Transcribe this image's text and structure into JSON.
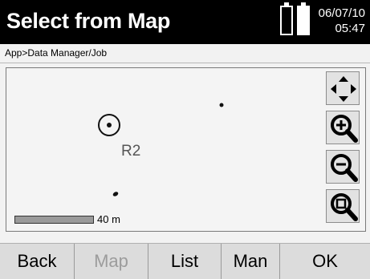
{
  "header": {
    "title": "Select from Map",
    "date": "06/07/10",
    "time": "05:47"
  },
  "breadcrumb": "App>Data Manager/Job",
  "map": {
    "selected_point_label": "R2",
    "scale_label": "40 m"
  },
  "map_controls": [
    {
      "name": "pan-button",
      "icon": "pan-arrows-icon"
    },
    {
      "name": "zoom-in-button",
      "icon": "zoom-in-icon"
    },
    {
      "name": "zoom-out-button",
      "icon": "zoom-out-icon"
    },
    {
      "name": "zoom-fit-button",
      "icon": "zoom-fit-icon"
    }
  ],
  "softkeys": {
    "back": "Back",
    "map": "Map",
    "list": "List",
    "man": "Man",
    "ok": "OK"
  },
  "colors": {
    "titlebar_bg": "#000000",
    "title_text": "#ffffff",
    "disabled_key_text": "#9c9c9c"
  }
}
